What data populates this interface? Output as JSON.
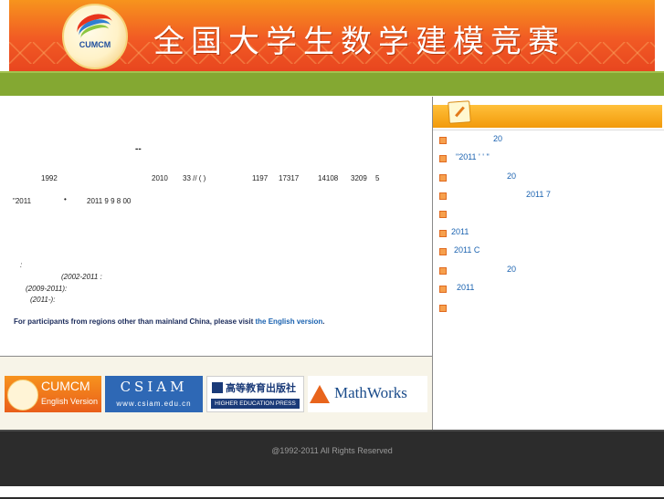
{
  "header": {
    "title": "全国大学生数学建模竞赛",
    "logo_text": "CUMCM"
  },
  "main": {
    "heading_mark": "--",
    "intro_line1": {
      "year_start": "1992",
      "year_end": "2010",
      "n1": "33 // (     )",
      "n2": "1197",
      "n3": "17317",
      "n4": "14108",
      "n5": "3209",
      "n6": "5"
    },
    "intro_line2": {
      "quote": "\"2011",
      "dot": "•",
      "date": "2011 9 9   8 00"
    },
    "colon_mark": ":",
    "term1": "(2002-2011  :",
    "term2": "(2009-2011):",
    "term3": "(2011-):",
    "english_prefix": "For participants from regions other than mainland China, please visit ",
    "english_link": "the English version",
    "english_suffix": "."
  },
  "partners": {
    "cumcm_title": "CUMCM",
    "cumcm_sub": "English Version",
    "csiam_title": "CSIAM",
    "csiam_url": "www.csiam.edu.cn",
    "hep_cn": "高等教育出版社",
    "hep_en": "HIGHER EDUCATION PRESS",
    "mathworks": "MathWorks"
  },
  "sidebar": {
    "news": [
      {
        "text": "20"
      },
      {
        "text": "\"2011 '  '          \""
      },
      {
        "text": "20"
      },
      {
        "text": "2011 7"
      },
      {
        "text": ""
      },
      {
        "text": "2011"
      },
      {
        "text": "2011      C"
      },
      {
        "text": "20"
      },
      {
        "text": "2011"
      },
      {
        "text": ""
      }
    ]
  },
  "footer": {
    "copyright": "@1992-2011 All Rights Reserved"
  }
}
